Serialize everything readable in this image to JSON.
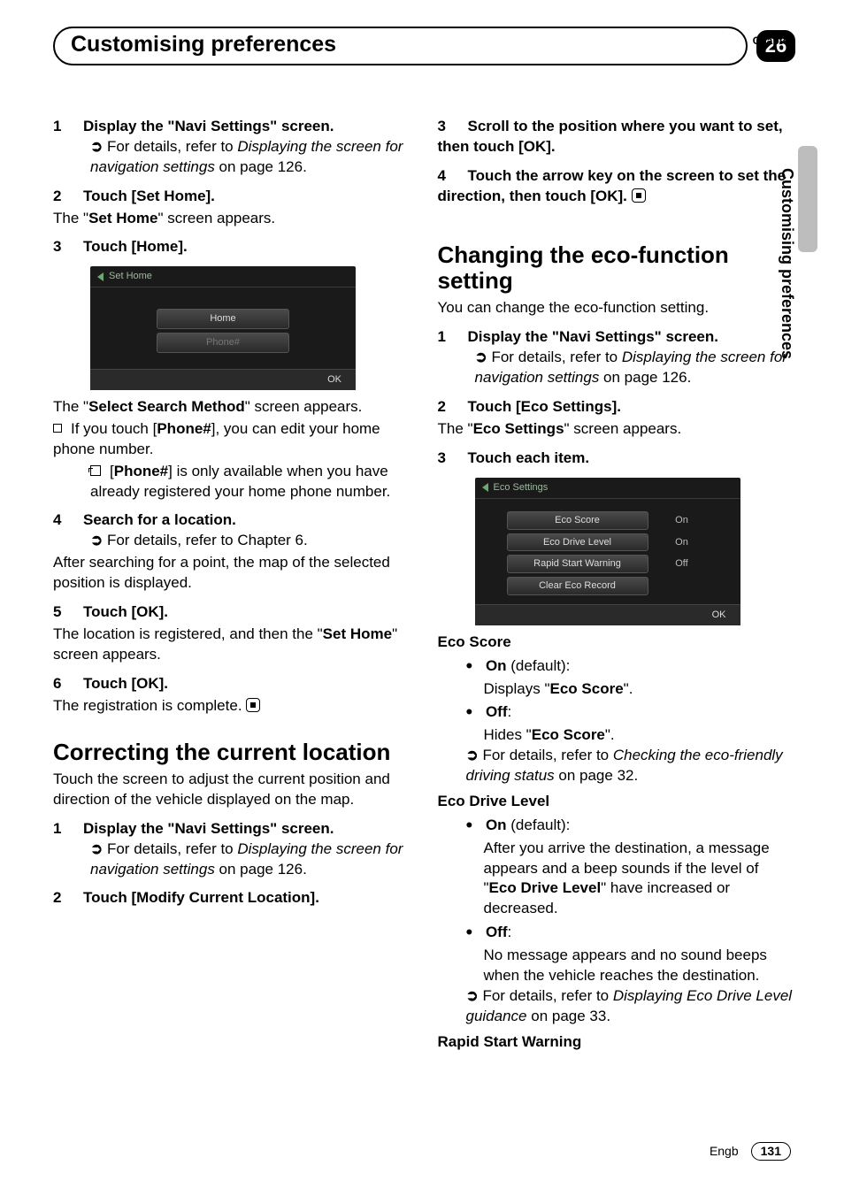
{
  "header": {
    "chapter_label": "Chapter",
    "chapter_number": "26",
    "title": "Customising preferences",
    "side_label": "Customising preferences"
  },
  "footer": {
    "lang": "Engb",
    "page": "131"
  },
  "left": {
    "s1": {
      "num": "1",
      "title": "Display the \"Navi Settings\" screen.",
      "ref_pre": "For details, refer to ",
      "ref_italic": "Displaying the screen for navigation settings",
      "ref_post": " on page 126."
    },
    "s2": {
      "num": "2",
      "title": "Touch [Set Home].",
      "body_pre": "The \"",
      "body_bold": "Set Home",
      "body_post": "\" screen appears."
    },
    "s3": {
      "num": "3",
      "title": "Touch [Home]."
    },
    "screenshot1": {
      "title": "Set Home",
      "btn_home": "Home",
      "btn_phone": "Phone#",
      "ok": "OK"
    },
    "after_ss_pre": "The \"",
    "after_ss_bold": "Select Search Method",
    "after_ss_post": "\" screen appears.",
    "bullet_phone_pre": "If you touch [",
    "bullet_phone_bold": "Phone#",
    "bullet_phone_post": "], you can edit your home phone number.",
    "note_phone_pre": "[",
    "note_phone_bold": "Phone#",
    "note_phone_post": "] is only available when you have already registered your home phone number.",
    "s4": {
      "num": "4",
      "title": "Search for a location.",
      "ref_pre": "For details, refer to Chapter 6.",
      "body": "After searching for a point, the map of the selected position is displayed."
    },
    "s5": {
      "num": "5",
      "title": "Touch [OK].",
      "body_pre": "The location is registered, and then the \"",
      "body_bold": "Set Home",
      "body_post": "\" screen appears."
    },
    "s6": {
      "num": "6",
      "title": "Touch [OK].",
      "body": "The registration is complete."
    },
    "sec_correct": {
      "heading": "Correcting the current location",
      "intro": "Touch the screen to adjust the current position and direction of the vehicle displayed on the map."
    },
    "c1": {
      "num": "1",
      "title": "Display the \"Navi Settings\" screen.",
      "ref_pre": "For details, refer to ",
      "ref_italic": "Displaying the screen for navigation settings",
      "ref_post": " on page 126."
    },
    "c2": {
      "num": "2",
      "title": "Touch [Modify Current Location]."
    }
  },
  "right": {
    "c3": {
      "num": "3",
      "title": "Scroll to the position where you want to set, then touch [OK]."
    },
    "c4": {
      "num": "4",
      "title": "Touch the arrow key on the screen to set the direction, then touch [OK]."
    },
    "sec_eco": {
      "heading": "Changing the eco-function setting",
      "intro": "You can change the eco-function setting."
    },
    "e1": {
      "num": "1",
      "title": "Display the \"Navi Settings\" screen.",
      "ref_pre": "For details, refer to ",
      "ref_italic": "Displaying the screen for navigation settings",
      "ref_post": " on page 126."
    },
    "e2": {
      "num": "2",
      "title": "Touch [Eco Settings].",
      "body_pre": "The \"",
      "body_bold": "Eco Settings",
      "body_post": "\" screen appears."
    },
    "e3": {
      "num": "3",
      "title": "Touch each item."
    },
    "screenshot2": {
      "title": "Eco Settings",
      "rows": [
        {
          "label": "Eco Score",
          "value": "On"
        },
        {
          "label": "Eco Drive Level",
          "value": "On"
        },
        {
          "label": "Rapid Start Warning",
          "value": "Off"
        },
        {
          "label": "Clear Eco Record",
          "value": ""
        }
      ],
      "ok": "OK"
    },
    "eco_score": {
      "head": "Eco Score",
      "on_label": "On",
      "on_suffix": " (default):",
      "on_body_pre": "Displays \"",
      "on_body_bold": "Eco Score",
      "on_body_post": "\".",
      "off_label": "Off",
      "off_suffix": ":",
      "off_body_pre": "Hides \"",
      "off_body_bold": "Eco Score",
      "off_body_post": "\".",
      "ref_pre": "For details, refer to ",
      "ref_italic": "Checking the eco-friendly driving status",
      "ref_post": " on page 32."
    },
    "eco_drive": {
      "head": "Eco Drive Level",
      "on_label": "On",
      "on_suffix": " (default):",
      "on_body_pre": "After you arrive the destination, a message appears and a beep sounds if the level of \"",
      "on_body_bold": "Eco Drive Level",
      "on_body_post": "\" have increased or decreased.",
      "off_label": "Off",
      "off_suffix": ":",
      "off_body": "No message appears and no sound beeps when the vehicle reaches the destination.",
      "ref_pre": "For details, refer to ",
      "ref_italic": "Displaying Eco Drive Level guidance",
      "ref_post": " on page 33."
    },
    "rapid_head": "Rapid Start Warning"
  }
}
